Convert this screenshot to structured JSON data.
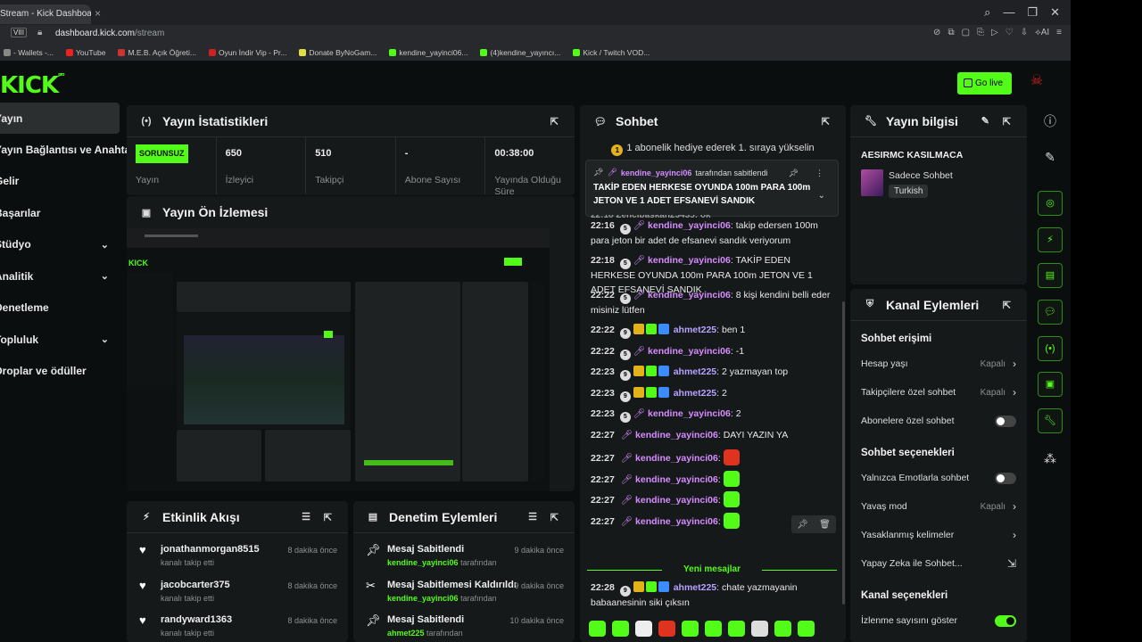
{
  "browser": {
    "tab_title": "Stream - Kick Dashboard",
    "url_domain": "dashboard.kick.com",
    "url_path": "/stream",
    "badge": "VIII",
    "bookmarks": [
      "- Wallets -...",
      "YouTube",
      "M.E.B. Açık Öğreti...",
      "Oyun İndir Vip - Pr...",
      "Donate ByNoGam...",
      "kendine_yayinci06...",
      "(4)kendine_yayıncı...",
      "Kick / Twitch VOD..."
    ]
  },
  "header": {
    "logo": "KICK",
    "logo_sup": "pro",
    "go_live_label": "Go live"
  },
  "nav": {
    "items": [
      {
        "label": "Yayın",
        "active": true,
        "chevron": false
      },
      {
        "label": "Yayın Bağlantısı ve Anahtarı",
        "active": false,
        "chevron": false
      },
      {
        "label": "Gelir",
        "active": false,
        "chevron": false
      },
      {
        "label": "Başarılar",
        "active": false,
        "chevron": false
      },
      {
        "label": "Stüdyo",
        "active": false,
        "chevron": true
      },
      {
        "label": "Analitik",
        "active": false,
        "chevron": true
      },
      {
        "label": "Denetleme",
        "active": false,
        "chevron": false
      },
      {
        "label": "Topluluk",
        "active": false,
        "chevron": true
      },
      {
        "label": "Droplar ve ödüller",
        "active": false,
        "chevron": false
      }
    ]
  },
  "stats_panel": {
    "title": "Yayın İstatistikleri",
    "status_badge": "SORUNSUZ",
    "items": [
      {
        "value": "",
        "label": "Yayın"
      },
      {
        "value": "650",
        "label": "İzleyici"
      },
      {
        "value": "510",
        "label": "Takipçi"
      },
      {
        "value": "-",
        "label": "Abone Sayısı"
      },
      {
        "value": "00:38:00",
        "label": "Yayında Olduğu Süre"
      }
    ]
  },
  "preview_panel": {
    "title": "Yayın Ön İzlemesi"
  },
  "events_panel": {
    "title": "Etkinlik Akışı",
    "items": [
      {
        "name": "jonathanmorgan8515",
        "sub": "kanalı takip etti",
        "time": "8 dakika önce"
      },
      {
        "name": "jacobcarter375",
        "sub": "kanalı takip etti",
        "time": "8 dakika önce"
      },
      {
        "name": "randyward1363",
        "sub": "kanalı takip etti",
        "time": "8 dakika önce"
      }
    ]
  },
  "moderation_panel": {
    "title": "Denetim Eylemleri",
    "items": [
      {
        "action": "Mesaj Sabitlendi",
        "user": "kendine_yayinci06",
        "suffix": "tarafından",
        "time": "9 dakika önce"
      },
      {
        "action": "Mesaj Sabitlemesi Kaldırıldı",
        "user": "kendine_yayinci06",
        "suffix": "tarafından",
        "time": "9 dakika önce"
      },
      {
        "action": "Mesaj Sabitlendi",
        "user": "ahmet225",
        "suffix": "tarafından",
        "time": "10 dakika önce"
      }
    ]
  },
  "chat_panel": {
    "title": "Sohbet",
    "top_banner": "1 abonelik hediye ederek 1. sıraya yükselin",
    "pinned": {
      "user": "kendine_yayinci06",
      "suffix": "tarafından sabitlendi",
      "message": "TAKİP EDEN HERKESE OYUNDA 100m PARA 100m JETON VE 1 ADET EFSANEVİ SANDIK"
    },
    "partial_line": "22:18  Zencibaskan23435: ok",
    "messages": [
      {
        "time": "22:16",
        "user": "kendine_yayinci06",
        "badge": "5",
        "text": "takip edersen 100m para jeton bir adet de efsanevi sandık veriyorum",
        "type": "host"
      },
      {
        "time": "22:18",
        "user": "kendine_yayinci06",
        "badge": "5",
        "text": "TAKİP EDEN HERKESE OYUNDA 100m PARA 100m JETON VE 1 ADET EFSANEVİ SANDIK",
        "type": "host"
      },
      {
        "time": "22:22",
        "user": "kendine_yayinci06",
        "badge": "5",
        "text": "8 kişi kendini belli eder misiniz lütfen",
        "type": "host"
      },
      {
        "time": "22:22",
        "user": "ahmet225",
        "badge": "9",
        "text": "ben 1",
        "type": "mod"
      },
      {
        "time": "22:22",
        "user": "kendine_yayinci06",
        "badge": "5",
        "text": "-1",
        "type": "host"
      },
      {
        "time": "22:23",
        "user": "ahmet225",
        "badge": "9",
        "text": "2 yazmayan top",
        "type": "mod"
      },
      {
        "time": "22:23",
        "user": "ahmet225",
        "badge": "9",
        "text": "2",
        "type": "mod"
      },
      {
        "time": "22:23",
        "user": "kendine_yayinci06",
        "badge": "5",
        "text": "2",
        "type": "host"
      },
      {
        "time": "22:27",
        "user": "kendine_yayinci06",
        "badge": "",
        "text": "DAYI YAZIN YA",
        "type": "host"
      },
      {
        "time": "22:27",
        "user": "kendine_yayinci06",
        "badge": "",
        "text": "",
        "type": "host",
        "emote": "#e0331f"
      },
      {
        "time": "22:27",
        "user": "kendine_yayinci06",
        "badge": "",
        "text": "",
        "type": "host",
        "emote": "#53fc18"
      },
      {
        "time": "22:27",
        "user": "kendine_yayinci06",
        "badge": "",
        "text": "",
        "type": "host",
        "emote": "#53fc18"
      },
      {
        "time": "22:27",
        "user": "kendine_yayinci06",
        "badge": "",
        "text": "",
        "type": "host",
        "emote": "#53fc18"
      }
    ],
    "new_messages_label": "Yeni mesajlar",
    "last_message": {
      "time": "22:28",
      "user": "ahmet225",
      "badge": "9",
      "text": "chate yazmayanin babaanesinin siki çıksın"
    }
  },
  "info_panel": {
    "title": "Yayın bilgisi",
    "stream_title": "AESIRMC KASILMACA",
    "category": "Sadece Sohbet",
    "tag": "Turkish"
  },
  "actions_panel": {
    "title": "Kanal Eylemleri",
    "sections": [
      {
        "heading": "Sohbet erişimi",
        "options": [
          {
            "label": "Hesap yaşı",
            "value": "Kapalı",
            "kind": "arrow"
          },
          {
            "label": "Takipçilere özel sohbet",
            "value": "Kapalı",
            "kind": "arrow"
          },
          {
            "label": "Abonelere özel sohbet",
            "value": "",
            "kind": "toggle-off"
          }
        ]
      },
      {
        "heading": "Sohbet seçenekleri",
        "options": [
          {
            "label": "Yalnızca Emotlarla sohbet",
            "value": "",
            "kind": "toggle-off"
          },
          {
            "label": "Yavaş mod",
            "value": "Kapalı",
            "kind": "arrow"
          },
          {
            "label": "Yasaklanmış kelimeler",
            "value": "",
            "kind": "arrow"
          },
          {
            "label": "Yapay Zeka ile Sohbet...",
            "value": "",
            "kind": "external"
          }
        ]
      },
      {
        "heading": "Kanal seçenekleri",
        "options": [
          {
            "label": "İzlenme sayısını göster",
            "value": "",
            "kind": "toggle-on"
          }
        ]
      }
    ]
  },
  "colors": {
    "brand": "#53fc18",
    "mod": "#b7a2ff",
    "host": "#d68cff",
    "bg": "#0b0e0f",
    "panel": "#16191a"
  }
}
